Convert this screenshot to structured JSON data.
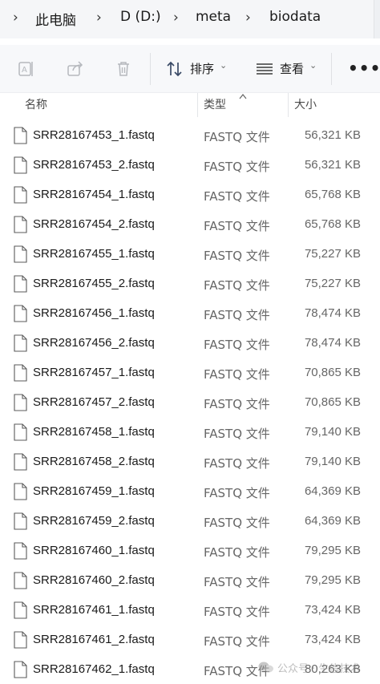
{
  "breadcrumb": {
    "items": [
      "此电脑",
      "D (D:)",
      "meta",
      "biodata"
    ]
  },
  "toolbar": {
    "icons": [
      "rename-icon",
      "share-icon",
      "delete-icon"
    ],
    "sort_label": "排序",
    "view_label": "查看",
    "more_label": "•••"
  },
  "columns": {
    "name": "名称",
    "type": "类型",
    "size": "大小",
    "sorted_by": "类型"
  },
  "files": [
    {
      "name": "SRR28167453_1.fastq",
      "type": "FASTQ 文件",
      "size": "56,321 KB"
    },
    {
      "name": "SRR28167453_2.fastq",
      "type": "FASTQ 文件",
      "size": "56,321 KB"
    },
    {
      "name": "SRR28167454_1.fastq",
      "type": "FASTQ 文件",
      "size": "65,768 KB"
    },
    {
      "name": "SRR28167454_2.fastq",
      "type": "FASTQ 文件",
      "size": "65,768 KB"
    },
    {
      "name": "SRR28167455_1.fastq",
      "type": "FASTQ 文件",
      "size": "75,227 KB"
    },
    {
      "name": "SRR28167455_2.fastq",
      "type": "FASTQ 文件",
      "size": "75,227 KB"
    },
    {
      "name": "SRR28167456_1.fastq",
      "type": "FASTQ 文件",
      "size": "78,474 KB"
    },
    {
      "name": "SRR28167456_2.fastq",
      "type": "FASTQ 文件",
      "size": "78,474 KB"
    },
    {
      "name": "SRR28167457_1.fastq",
      "type": "FASTQ 文件",
      "size": "70,865 KB"
    },
    {
      "name": "SRR28167457_2.fastq",
      "type": "FASTQ 文件",
      "size": "70,865 KB"
    },
    {
      "name": "SRR28167458_1.fastq",
      "type": "FASTQ 文件",
      "size": "79,140 KB"
    },
    {
      "name": "SRR28167458_2.fastq",
      "type": "FASTQ 文件",
      "size": "79,140 KB"
    },
    {
      "name": "SRR28167459_1.fastq",
      "type": "FASTQ 文件",
      "size": "64,369 KB"
    },
    {
      "name": "SRR28167459_2.fastq",
      "type": "FASTQ 文件",
      "size": "64,369 KB"
    },
    {
      "name": "SRR28167460_1.fastq",
      "type": "FASTQ 文件",
      "size": "79,295 KB"
    },
    {
      "name": "SRR28167460_2.fastq",
      "type": "FASTQ 文件",
      "size": "79,295 KB"
    },
    {
      "name": "SRR28167461_1.fastq",
      "type": "FASTQ 文件",
      "size": "73,424 KB"
    },
    {
      "name": "SRR28167461_2.fastq",
      "type": "FASTQ 文件",
      "size": "73,424 KB"
    },
    {
      "name": "SRR28167462_1.fastq",
      "type": "FASTQ 文件",
      "size": "80,263 KB"
    }
  ],
  "watermark": {
    "text": "公众号 · 生信技术"
  },
  "colors": {
    "background": "#ffffff",
    "toolbar_bg": "#f7f8fa",
    "address_bg": "#f5f6f8",
    "secondary_text": "#666666",
    "disabled_icon": "#b5b8bd"
  }
}
